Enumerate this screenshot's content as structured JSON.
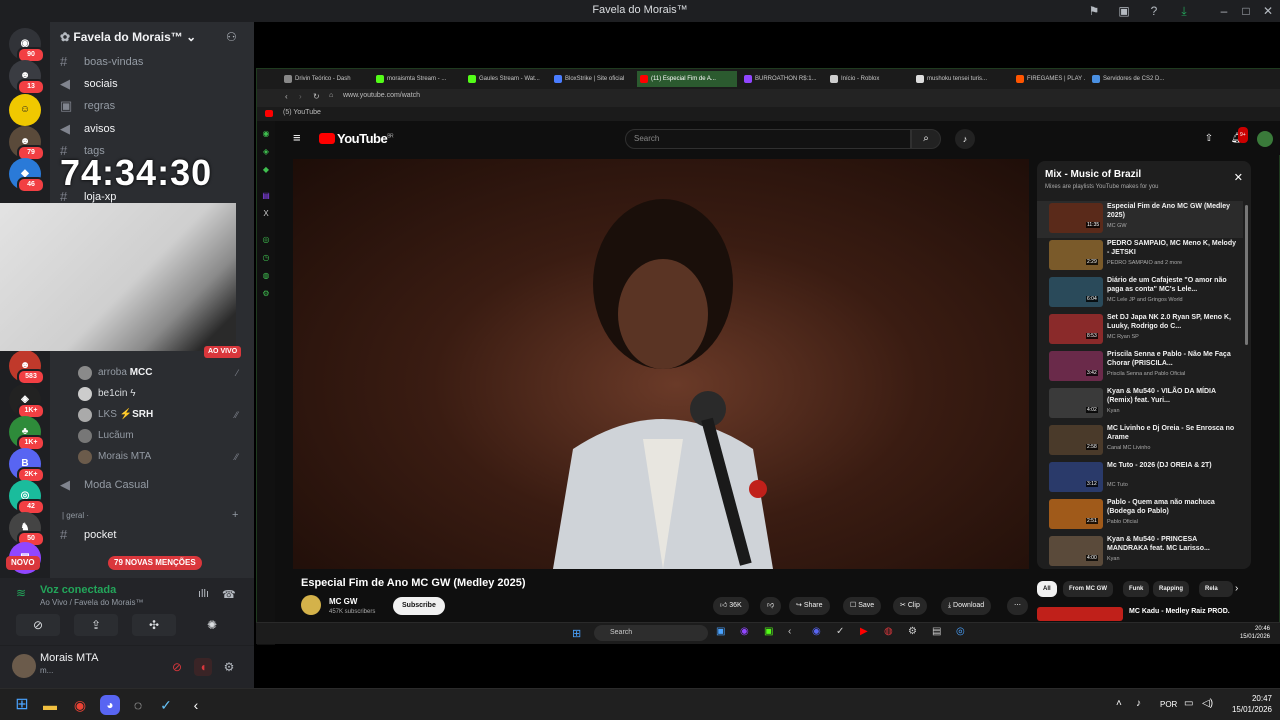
{
  "window": {
    "title": "Favela do Morais™"
  },
  "rail": {
    "servers": [
      {
        "badge": "90"
      },
      {
        "badge": "13"
      },
      {
        "badge": ""
      },
      {
        "badge": "79"
      },
      {
        "badge": "46"
      },
      {
        "badge": "583"
      },
      {
        "badge": "1K+"
      },
      {
        "badge": "1K+"
      },
      {
        "badge": "2K+"
      },
      {
        "badge": "42"
      },
      {
        "badge": "50"
      },
      {
        "badge": "NOVO"
      }
    ]
  },
  "guild": {
    "name": "Favela do Morais™",
    "channels": [
      {
        "name": "boas-vindas"
      },
      {
        "name": "sociais"
      },
      {
        "name": "regras"
      },
      {
        "name": "avisos"
      },
      {
        "name": "tags"
      },
      {
        "name": "loja-xp"
      }
    ],
    "live_label": "AO VIVO",
    "voice_users": [
      {
        "name": "arroba",
        "tag": "MCC"
      },
      {
        "name": "be1cin ϟ",
        "tag": ""
      },
      {
        "name": "LKS",
        "tag": "⚡SRH"
      },
      {
        "name": "Lucãum",
        "tag": ""
      },
      {
        "name": "Morais MTA",
        "tag": ""
      }
    ],
    "voice_channel": "Moda Casual",
    "category": "| geral ·",
    "text_channel": "pocket",
    "mentions": "79 NOVAS MENÇÕES",
    "novo": "NOVO"
  },
  "timer": "74:34:30",
  "voice": {
    "status": "Voz conectada",
    "location": "Ao Vivo / Favela do Morais™"
  },
  "user": {
    "name": "Morais MTA",
    "status": "m..."
  },
  "taskbar": {
    "lang": "POR",
    "time": "20:47",
    "date": "15/01/2026"
  },
  "browser": {
    "tabs": [
      {
        "label": "Drivin Teórico - Dash",
        "color": "#888"
      },
      {
        "label": "moraismta Stream - ...",
        "color": "#53fc18"
      },
      {
        "label": "Gaules Stream - Wat...",
        "color": "#53fc18"
      },
      {
        "label": "BloxStrike | Site oficial",
        "color": "#4a7dff"
      },
      {
        "label": "(11) Especial Fim de A...",
        "color": "#ff0000"
      },
      {
        "label": "BURROATHON R$:1...",
        "color": "#9146ff"
      },
      {
        "label": "Início - Roblox",
        "color": "#ccc"
      },
      {
        "label": "mushoku tensei turis...",
        "color": "#ddd"
      },
      {
        "label": "FIREGAMES | PLAY ...",
        "color": "#ff5500"
      },
      {
        "label": "Servidores de CS2 D...",
        "color": "#4a90e2"
      }
    ],
    "url": "www.youtube.com/watch",
    "bookmark": "(5) YouTube"
  },
  "youtube": {
    "logo": "YouTube",
    "logo_sup": "BR",
    "search_placeholder": "Search",
    "notif_count": "9+",
    "video_title": "Especial Fim de Ano MC GW (Medley 2025)",
    "channel": "MC GW",
    "subs": "457K subscribers",
    "subscribe": "Subscribe",
    "likes": "36K",
    "share": "Share",
    "save": "Save",
    "clip": "Clip",
    "download": "Download",
    "mix": {
      "title": "Mix - Music of Brazil",
      "subtitle": "Mixes are playlists YouTube makes for you",
      "items": [
        {
          "title": "Especial Fim de Ano MC GW (Medley 2025)",
          "author": "MC GW",
          "dur": "11:35",
          "color": "#5a2a1a"
        },
        {
          "title": "PEDRO SAMPAIO, MC Meno K, Melody - JETSKI",
          "author": "PEDRO SAMPAIO and 2 more",
          "dur": "2:29",
          "color": "#7a5a2a"
        },
        {
          "title": "Diário de um Cafajeste \"O amor não paga as conta\" MC's Lele...",
          "author": "MC Lele JP and Gringos World",
          "dur": "6:04",
          "color": "#2a4a5a"
        },
        {
          "title": "Set DJ Japa NK 2.0 Ryan SP, Meno K, Luuky, Rodrigo do C...",
          "author": "MC Ryan SP",
          "dur": "8:53",
          "color": "#8a2a2a"
        },
        {
          "title": "Priscila Senna e Pablo - Não Me Faça Chorar (PRISCILA...",
          "author": "Priscila Senna and Pablo Oficial",
          "dur": "3:42",
          "color": "#6a2a4a"
        },
        {
          "title": "Kyan & Mu540 - VILÃO DA MÍDIA (Remix) feat. Yuri...",
          "author": "Kyan",
          "dur": "4:02",
          "color": "#3a3a3a"
        },
        {
          "title": "MC Livinho e Dj Oreia - Se Enrosca no Arame",
          "author": "Canal MC Livinho",
          "dur": "2:58",
          "color": "#4a3a2a"
        },
        {
          "title": "Mc Tuto - 2026 (DJ OREIA & 2T)",
          "author": "MC Tuto",
          "dur": "3:12",
          "color": "#2a3a6a"
        },
        {
          "title": "Pablo - Quem ama não machuca (Bodega do Pablo)",
          "author": "Pablo Oficial",
          "dur": "2:51",
          "color": "#a05a1a"
        },
        {
          "title": "Kyan & Mu540 - PRINCESA MANDRAKA feat. MC Larisso...",
          "author": "Kyan",
          "dur": "4:00",
          "color": "#5a4a3a"
        }
      ]
    },
    "chips": [
      "All",
      "From MC GW",
      "Funk",
      "Rapping",
      "Rela"
    ],
    "next_title": "MC Kadu - Medley Raiz PROD."
  },
  "inner_taskbar": {
    "search": "Search",
    "time": "20:46",
    "date": "15/01/2026"
  }
}
